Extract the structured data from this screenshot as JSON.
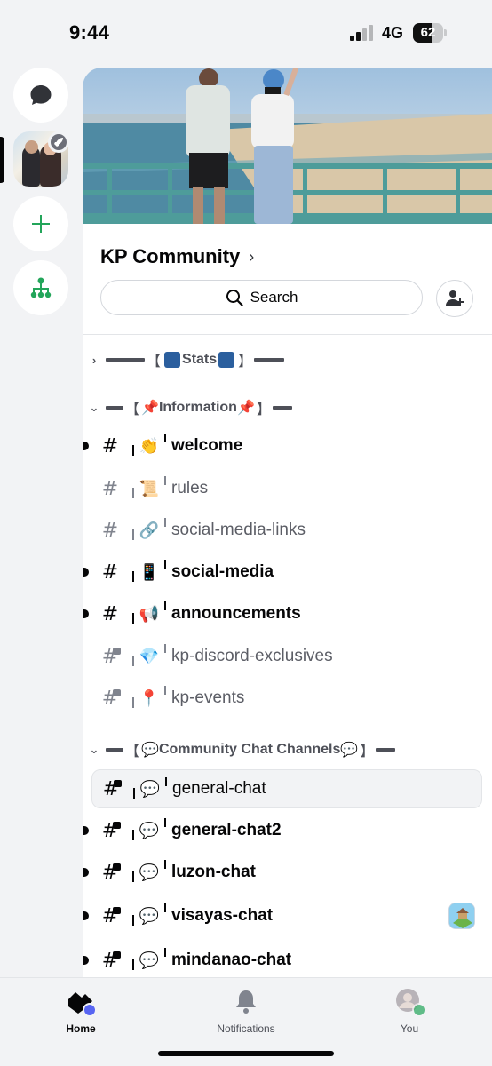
{
  "status": {
    "time": "9:44",
    "network": "4G",
    "battery": "62",
    "battery_level": 0.62,
    "signal_bars": 2
  },
  "rail": {
    "dm_icon": "chat-bubble-icon",
    "server_badge_icon": "rocket-icon",
    "add_icon": "plus-icon",
    "discover_icon": "hub-icon"
  },
  "server": {
    "name": "KP Community",
    "search_placeholder": "Search"
  },
  "categories": [
    {
      "label": "Stats",
      "expanded": false
    },
    {
      "label": "Information",
      "expanded": true
    },
    {
      "label": "Community Chat Channels",
      "expanded": true
    }
  ],
  "channels": [
    {
      "name": "welcome",
      "emoji": "👏",
      "unread": true,
      "locked": false
    },
    {
      "name": "rules",
      "emoji": "📜",
      "unread": false,
      "locked": false
    },
    {
      "name": "social-media-links",
      "emoji": "🔗",
      "unread": false,
      "locked": false
    },
    {
      "name": "social-media",
      "emoji": "📱",
      "unread": true,
      "locked": false
    },
    {
      "name": "announcements",
      "emoji": "📢",
      "unread": true,
      "locked": false
    },
    {
      "name": "kp-discord-exclusives",
      "emoji": "💎",
      "unread": false,
      "locked": true
    },
    {
      "name": "kp-events",
      "emoji": "📍",
      "unread": false,
      "locked": true
    },
    {
      "name": "general-chat",
      "emoji": "💬",
      "unread": false,
      "locked": true,
      "selected": true
    },
    {
      "name": "general-chat2",
      "emoji": "💬",
      "unread": true,
      "locked": true
    },
    {
      "name": "luzon-chat",
      "emoji": "💬",
      "unread": true,
      "locked": true
    },
    {
      "name": "visayas-chat",
      "emoji": "💬",
      "unread": true,
      "locked": true,
      "app_icon": true
    },
    {
      "name": "mindanao-chat",
      "emoji": "💬",
      "unread": true,
      "locked": true
    }
  ],
  "nav": {
    "home": "Home",
    "notifications": "Notifications",
    "you": "You"
  },
  "colors": {
    "accent": "#5865f2",
    "online": "#23a55a",
    "green_icon": "#23a55a"
  }
}
